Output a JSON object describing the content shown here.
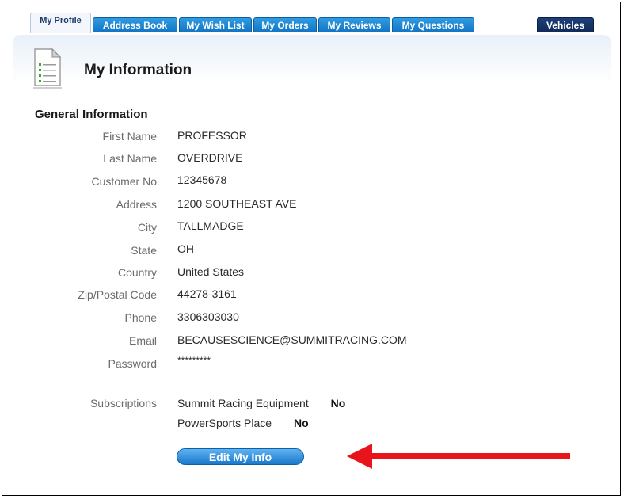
{
  "tabs": [
    {
      "label": "My Profile",
      "active": true
    },
    {
      "label": "Address Book"
    },
    {
      "label": "My Wish List"
    },
    {
      "label": "My Orders"
    },
    {
      "label": "My Reviews"
    },
    {
      "label": "My Questions"
    },
    {
      "label": "Vehicles"
    }
  ],
  "page_title": "My Information",
  "section_title": "General Information",
  "fields": [
    {
      "label": "First Name",
      "value": "PROFESSOR"
    },
    {
      "label": "Last Name",
      "value": "OVERDRIVE"
    },
    {
      "label": "Customer No",
      "value": "12345678"
    },
    {
      "label": "Address",
      "value": "1200 SOUTHEAST AVE"
    },
    {
      "label": "City",
      "value": "TALLMADGE"
    },
    {
      "label": "State",
      "value": "OH"
    },
    {
      "label": "Country",
      "value": "United States"
    },
    {
      "label": "Zip/Postal Code",
      "value": "44278-3161"
    },
    {
      "label": "Phone",
      "value": "3306303030"
    },
    {
      "label": "Email",
      "value": "BECAUSESCIENCE@SUMMITRACING.COM"
    },
    {
      "label": "Password",
      "value": "*********"
    }
  ],
  "subscriptions": {
    "label": "Subscriptions",
    "items": [
      {
        "name": "Summit Racing Equipment",
        "value": "No"
      },
      {
        "name": "PowerSports Place",
        "value": "No"
      }
    ]
  },
  "edit_button_label": "Edit My Info",
  "colors": {
    "tab_blue": "#1a82d2",
    "vehicles_tab": "#153466",
    "arrow_red": "#e8141b"
  }
}
